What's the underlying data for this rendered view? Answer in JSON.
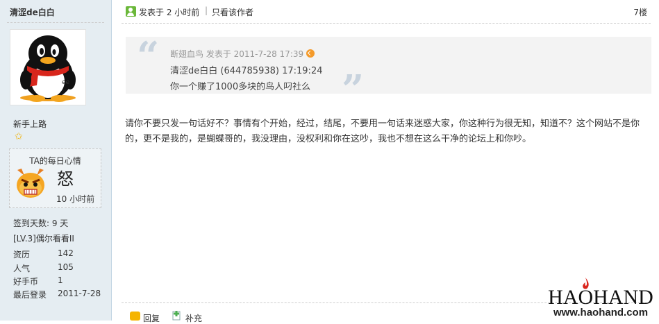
{
  "user": {
    "name": "清涩de白白",
    "rank": "新手上路",
    "mood": {
      "title": "TA的每日心情",
      "word": "怒",
      "time": "10 小时前"
    },
    "signin": "签到天数: 9 天",
    "level": "[LV.3]偶尔看看II",
    "stats": [
      {
        "label": "资历",
        "value": "142"
      },
      {
        "label": "人气",
        "value": "105"
      },
      {
        "label": "好手币",
        "value": "1"
      },
      {
        "label": "最后登录",
        "value": "2011-7-28"
      }
    ]
  },
  "post": {
    "posted": "发表于 2 小时前",
    "separator": "|",
    "author_only": "只看该作者",
    "floor": "7楼",
    "quote": {
      "meta": "断翅血鸟 发表于 2011-7-28 17:39",
      "line1": "清涩de白白 (644785938) 17:19:24",
      "line2": "你一个赚了1000多块的鸟人叼社么"
    },
    "message": "请你不要只发一句话好不？事情有个开始，经过，结尾，不要用一句话来迷惑大家，你这种行为很无知，知道不？这个网站不是你的，更不是我的，是蝴蝶哥的，我没理由，没权利和你在这吵，我也不想在这么干净的论坛上和你吵。",
    "actions": {
      "reply": "回复",
      "add": "补充"
    }
  },
  "watermark": {
    "brand": "HAOHAND",
    "url": "www.haohand.com"
  },
  "colors": {
    "sidebar_bg": "#e5edf2",
    "quote_bg": "#f3f3f3",
    "online_icon": "#6bb83a",
    "star": "#f0b000"
  }
}
